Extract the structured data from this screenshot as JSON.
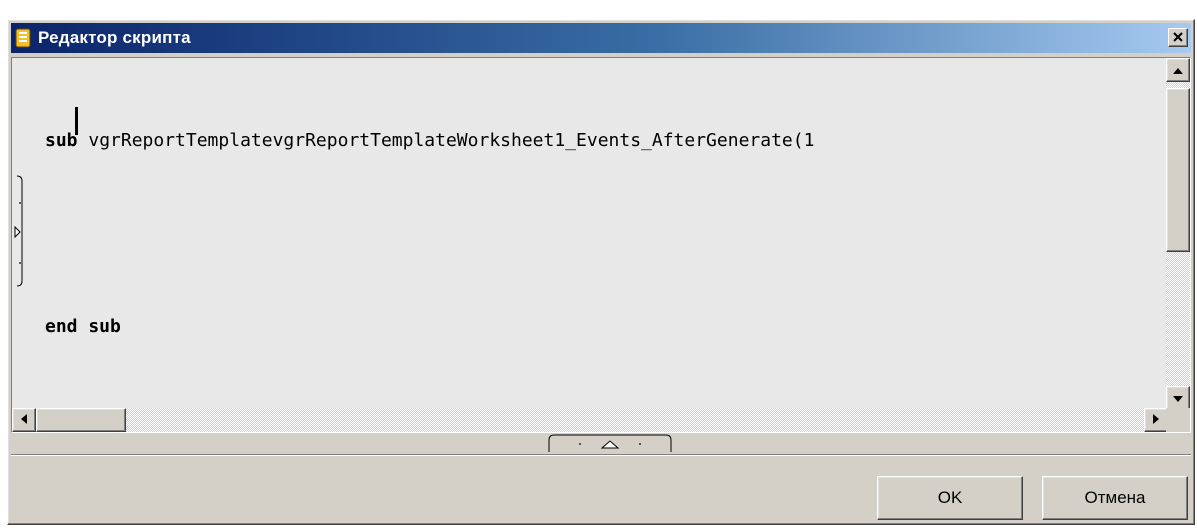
{
  "window": {
    "title": "Редактор скрипта",
    "icon": "script-editor-app-icon",
    "close_glyph": "×"
  },
  "editor": {
    "lines": [
      {
        "keyword": "sub",
        "text": " vgrReportTemplatevgrReportTemplateWorksheet1_Events_AfterGenerate(1"
      },
      {
        "keyword": "",
        "text": ""
      },
      {
        "keyword": "end sub",
        "text": ""
      }
    ],
    "background": "#e8e8e8"
  },
  "buttons": {
    "ok_label": "OK",
    "cancel_label": "Отмена"
  },
  "colors": {
    "title_start": "#0a246a",
    "title_end": "#a6caf0",
    "face": "#d4d0c8"
  }
}
